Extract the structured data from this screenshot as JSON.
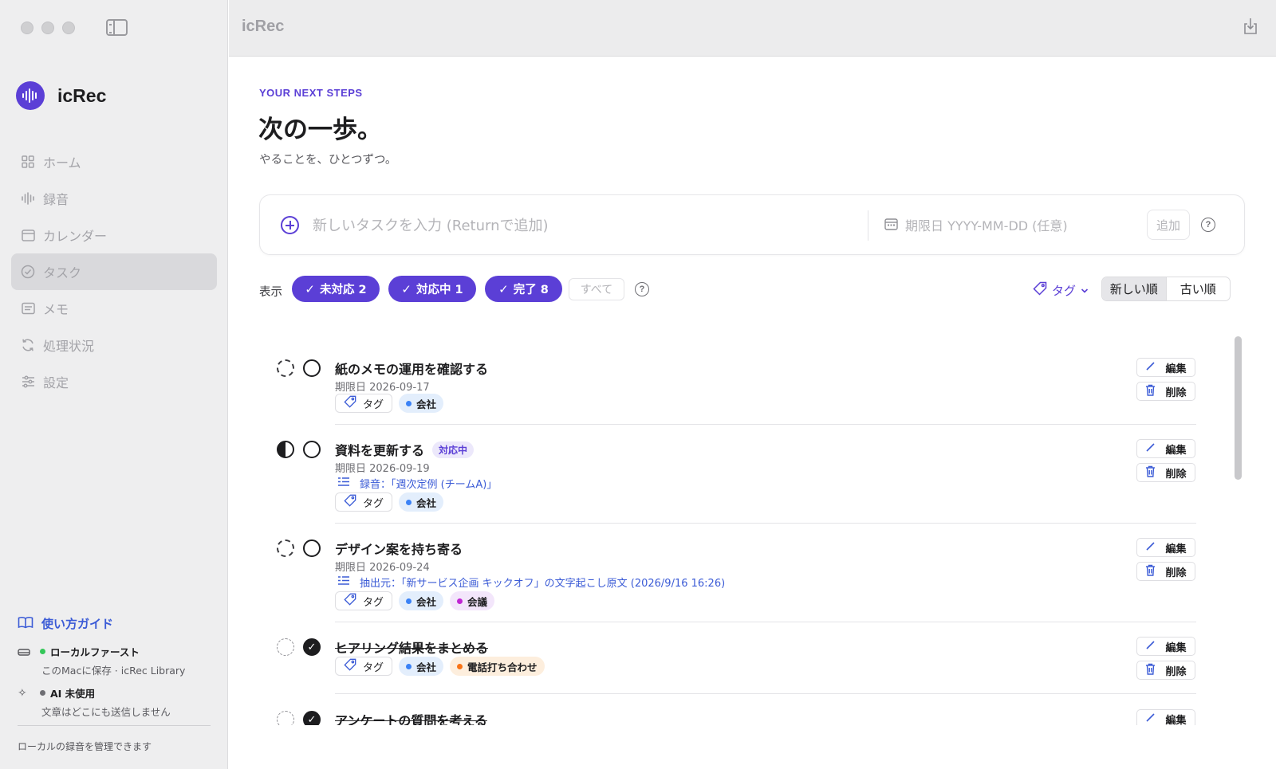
{
  "app": {
    "name": "icRec",
    "window_title": "icRec"
  },
  "sidebar": {
    "nav": [
      {
        "label": "ホーム",
        "icon": "grid-icon",
        "active": false
      },
      {
        "label": "録音",
        "icon": "waveform-icon",
        "active": false
      },
      {
        "label": "カレンダー",
        "icon": "calendar-icon",
        "active": false
      },
      {
        "label": "タスク",
        "icon": "check-circle-icon",
        "active": true
      },
      {
        "label": "メモ",
        "icon": "note-icon",
        "active": false
      },
      {
        "label": "処理状況",
        "icon": "sync-icon",
        "active": false
      },
      {
        "label": "設定",
        "icon": "sliders-icon",
        "active": false
      }
    ],
    "guide_label": "使い方ガイド",
    "local_first": {
      "title": "ローカルファースト",
      "sub": "このMacに保存 · icRec Library",
      "dot_color": "#34c759"
    },
    "ai": {
      "title": "AI 未使用",
      "sub": "文章はどこにも送信しません",
      "dot_color": "#6e6e73"
    },
    "footer": "ローカルの録音を管理できます"
  },
  "page": {
    "eyebrow": "YOUR NEXT STEPS",
    "title": "次の一歩。",
    "subtitle": "やることを、ひとつずつ。"
  },
  "new_task": {
    "placeholder": "新しいタスクを入力 (Returnで追加)",
    "date_placeholder": "期限日 YYYY-MM-DD (任意)",
    "add_label": "追加"
  },
  "filters": {
    "label": "表示",
    "chips": [
      "未対応 2",
      "対応中 1",
      "完了 8"
    ],
    "all_label": "すべて",
    "tag_label": "タグ",
    "sort": [
      "新しい順",
      "古い順"
    ],
    "sort_active": "新しい順"
  },
  "tasks": [
    {
      "title": "紙のメモの運用を確認する",
      "status": "todo",
      "done": false,
      "due": "期限日 2026-09-17",
      "tags": [
        {
          "name": "会社",
          "color": "#3b82f6"
        }
      ]
    },
    {
      "title": "資料を更新する",
      "status": "doing",
      "status_badge": "対応中",
      "done": false,
      "due": "期限日 2026-09-19",
      "link": "録音：「週次定例 (チームA)」",
      "tags": [
        {
          "name": "会社",
          "color": "#3b82f6"
        }
      ]
    },
    {
      "title": "デザイン案を持ち寄る",
      "status": "todo",
      "done": false,
      "due": "期限日 2026-09-24",
      "link": "抽出元：「新サービス企画 キックオフ」の文字起こし原文 (2026/9/16 16:26)",
      "tags": [
        {
          "name": "会社",
          "color": "#3b82f6"
        },
        {
          "name": "会議",
          "color": "#c026d3"
        }
      ]
    },
    {
      "title": "ヒアリング結果をまとめる",
      "status": "done",
      "done": true,
      "tags": [
        {
          "name": "会社",
          "color": "#3b82f6"
        },
        {
          "name": "電話打ち合わせ",
          "color": "#f97316"
        }
      ]
    },
    {
      "title": "アンケートの質問を考える",
      "status": "done",
      "done": true,
      "tags": []
    }
  ],
  "task_actions": {
    "edit": "編集",
    "delete": "削除",
    "tag": "タグ"
  },
  "colors": {
    "accent": "#5b3fd6",
    "link": "#3b5bd6"
  }
}
